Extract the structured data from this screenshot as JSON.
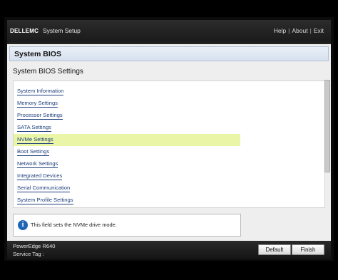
{
  "header": {
    "logo": "DELLEMC",
    "title": "System Setup",
    "links": [
      "Help",
      "About",
      "Exit"
    ],
    "separator": "|"
  },
  "page": {
    "title": "System BIOS",
    "subtitle": "System BIOS Settings"
  },
  "menu": {
    "items": [
      "System Information",
      "Memory Settings",
      "Processor Settings",
      "SATA Settings",
      "NVMe Settings",
      "Boot Settings",
      "Network Settings",
      "Integrated Devices",
      "Serial Communication",
      "System Profile Settings"
    ],
    "selected_index": 4,
    "selected_color": "#eaf5a8"
  },
  "help": {
    "icon": "info-icon",
    "text": "This field sets the NVMe drive mode."
  },
  "footer": {
    "model": "PowerEdge R640",
    "service_tag_label": "Service Tag :",
    "buttons": [
      "Default",
      "Finish"
    ]
  }
}
